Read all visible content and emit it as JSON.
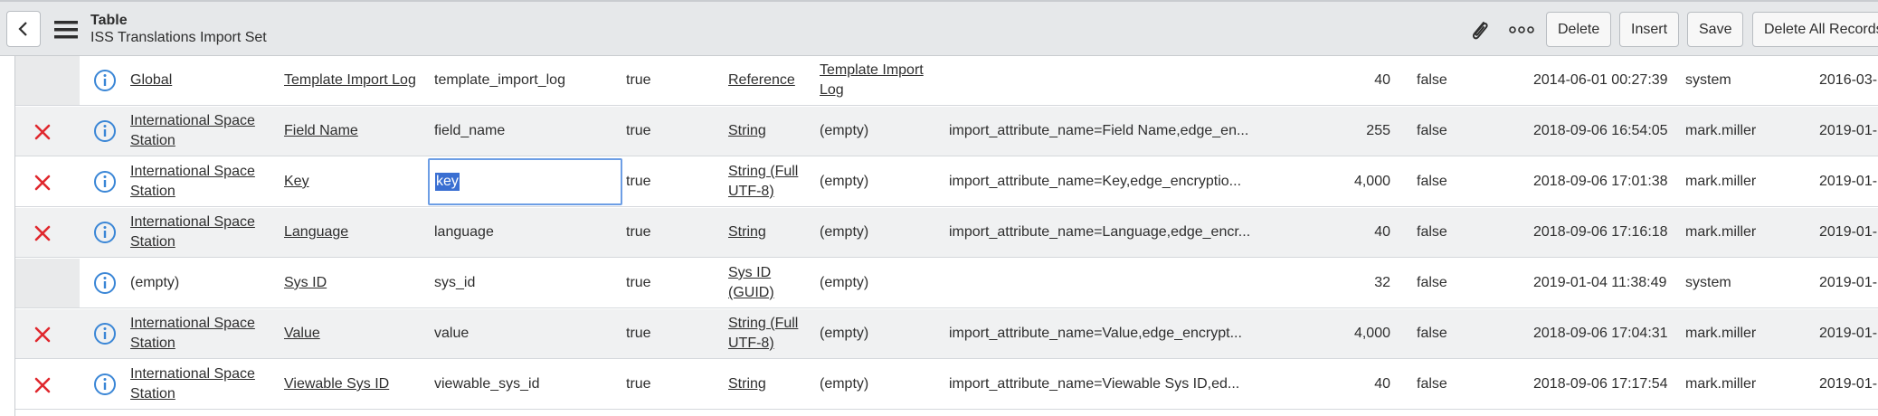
{
  "header": {
    "title": "Table",
    "subtitle": "ISS Translations Import Set",
    "buttons": {
      "delete": "Delete",
      "insert": "Insert",
      "save": "Save",
      "delete_all": "Delete All Records"
    },
    "icons": {
      "back": "chevron-left-icon",
      "menu": "hamburger-icon",
      "attachment": "paperclip-icon",
      "more": "more-options-icon"
    }
  },
  "rows": [
    {
      "deletable": false,
      "scope": "Global",
      "label": "Template Import Log",
      "name": "template_import_log",
      "active": "true",
      "type": "Reference",
      "reference": "Template Import Log",
      "attributes": "",
      "max_length": "40",
      "display": "false",
      "created": "2014-06-01 00:27:39",
      "created_by": "system",
      "updated": "2016-03-"
    },
    {
      "deletable": true,
      "scope": "International Space Station",
      "label": "Field Name",
      "name": "field_name",
      "active": "true",
      "type": "String",
      "reference": "(empty)",
      "attributes": "import_attribute_name=Field Name,edge_en...",
      "max_length": "255",
      "display": "false",
      "created": "2018-09-06 16:54:05",
      "created_by": "mark.miller",
      "updated": "2019-01-"
    },
    {
      "deletable": true,
      "scope": "International Space Station",
      "label": "Key",
      "name": "key",
      "editing": true,
      "active": "true",
      "type": "String (Full UTF-8)",
      "reference": "(empty)",
      "attributes": "import_attribute_name=Key,edge_encryptio...",
      "max_length": "4,000",
      "display": "false",
      "created": "2018-09-06 17:01:38",
      "created_by": "mark.miller",
      "updated": "2019-01-"
    },
    {
      "deletable": true,
      "scope": "International Space Station",
      "label": "Language",
      "name": "language",
      "active": "true",
      "type": "String",
      "reference": "(empty)",
      "attributes": "import_attribute_name=Language,edge_encr...",
      "max_length": "40",
      "display": "false",
      "created": "2018-09-06 17:16:18",
      "created_by": "mark.miller",
      "updated": "2019-01-"
    },
    {
      "deletable": false,
      "scope": "(empty)",
      "scope_plain": true,
      "label": "Sys ID",
      "name": "sys_id",
      "active": "true",
      "type": "Sys ID (GUID)",
      "reference": "(empty)",
      "attributes": "",
      "max_length": "32",
      "display": "false",
      "created": "2019-01-04 11:38:49",
      "created_by": "system",
      "updated": "2019-01-"
    },
    {
      "deletable": true,
      "scope": "International Space Station",
      "label": "Value",
      "name": "value",
      "active": "true",
      "type": "String (Full UTF-8)",
      "reference": "(empty)",
      "attributes": "import_attribute_name=Value,edge_encrypt...",
      "max_length": "4,000",
      "display": "false",
      "created": "2018-09-06 17:04:31",
      "created_by": "mark.miller",
      "updated": "2019-01-"
    },
    {
      "deletable": true,
      "scope": "International Space Station",
      "label": "Viewable Sys ID",
      "name": "viewable_sys_id",
      "active": "true",
      "type": "String",
      "reference": "(empty)",
      "attributes": "import_attribute_name=Viewable Sys ID,ed...",
      "max_length": "40",
      "display": "false",
      "created": "2018-09-06 17:17:54",
      "created_by": "mark.miller",
      "updated": "2019-01-"
    }
  ],
  "colors": {
    "delete_x": "#e0282e",
    "info": "#3a86d6",
    "selection": "#3a6fd2",
    "header_bg": "#e6e8ea"
  }
}
